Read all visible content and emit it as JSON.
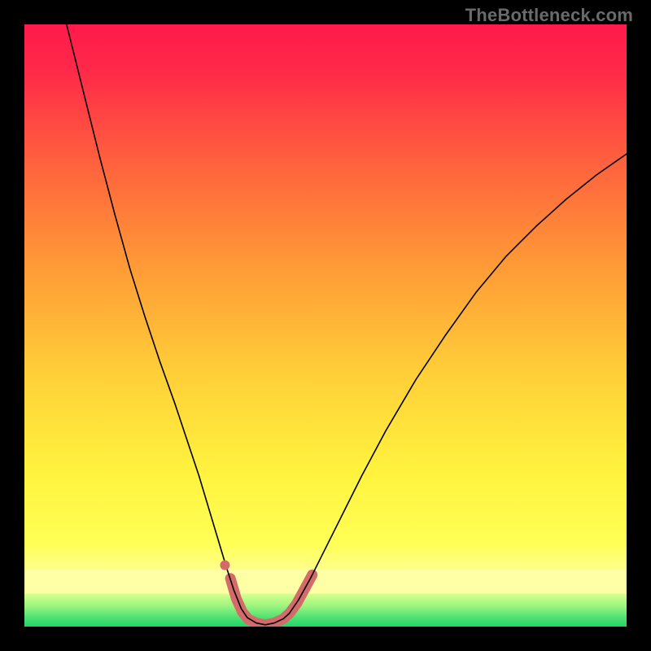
{
  "watermark": "TheBottleneck.com",
  "chart_data": {
    "type": "line",
    "title": "",
    "xlabel": "",
    "ylabel": "",
    "xlim": [
      0,
      100
    ],
    "ylim": [
      0,
      100
    ],
    "grid": false,
    "legend": false,
    "background_gradient": {
      "top_color": "#ff1a4b",
      "mid_color": "#ffe03a",
      "band_color": "#ffff8a",
      "bottom_color": "#2cdc6b"
    },
    "series": [
      {
        "name": "v-curve",
        "type": "line",
        "stroke": "#000000",
        "stroke_width": 1.6,
        "points": [
          {
            "x": 7.0,
            "y": 100.0
          },
          {
            "x": 8.0,
            "y": 96.0
          },
          {
            "x": 10.0,
            "y": 88.0
          },
          {
            "x": 12.5,
            "y": 78.0
          },
          {
            "x": 15.0,
            "y": 68.5
          },
          {
            "x": 17.5,
            "y": 59.5
          },
          {
            "x": 20.0,
            "y": 51.5
          },
          {
            "x": 22.5,
            "y": 44.0
          },
          {
            "x": 25.0,
            "y": 37.0
          },
          {
            "x": 27.0,
            "y": 31.0
          },
          {
            "x": 29.0,
            "y": 25.0
          },
          {
            "x": 30.5,
            "y": 20.0
          },
          {
            "x": 32.0,
            "y": 15.0
          },
          {
            "x": 33.5,
            "y": 10.0
          },
          {
            "x": 34.8,
            "y": 6.0
          },
          {
            "x": 36.0,
            "y": 3.0
          },
          {
            "x": 37.0,
            "y": 1.5
          },
          {
            "x": 38.5,
            "y": 0.6
          },
          {
            "x": 40.0,
            "y": 0.3
          },
          {
            "x": 41.5,
            "y": 0.6
          },
          {
            "x": 43.0,
            "y": 1.3
          },
          {
            "x": 44.0,
            "y": 2.2
          },
          {
            "x": 45.5,
            "y": 4.4
          },
          {
            "x": 47.5,
            "y": 8.0
          },
          {
            "x": 50.0,
            "y": 13.0
          },
          {
            "x": 53.0,
            "y": 19.0
          },
          {
            "x": 56.0,
            "y": 25.0
          },
          {
            "x": 60.0,
            "y": 32.5
          },
          {
            "x": 65.0,
            "y": 41.0
          },
          {
            "x": 70.0,
            "y": 48.5
          },
          {
            "x": 75.0,
            "y": 55.5
          },
          {
            "x": 80.0,
            "y": 61.5
          },
          {
            "x": 85.0,
            "y": 66.5
          },
          {
            "x": 90.0,
            "y": 71.0
          },
          {
            "x": 95.0,
            "y": 75.0
          },
          {
            "x": 100.0,
            "y": 78.5
          }
        ]
      },
      {
        "name": "highlight-band-left",
        "type": "line",
        "stroke": "#d46a6a",
        "stroke_width": 13,
        "linecap": "round",
        "points": [
          {
            "x": 34.2,
            "y": 8.0
          },
          {
            "x": 35.2,
            "y": 4.6
          },
          {
            "x": 36.2,
            "y": 2.4
          },
          {
            "x": 37.2,
            "y": 1.2
          },
          {
            "x": 38.5,
            "y": 0.6
          },
          {
            "x": 40.0,
            "y": 0.3
          },
          {
            "x": 41.5,
            "y": 0.6
          },
          {
            "x": 43.0,
            "y": 1.3
          },
          {
            "x": 44.0,
            "y": 2.2
          },
          {
            "x": 45.2,
            "y": 3.8
          },
          {
            "x": 46.4,
            "y": 6.0
          },
          {
            "x": 47.8,
            "y": 8.6
          }
        ]
      },
      {
        "name": "highlight-dot",
        "type": "scatter",
        "stroke": "#d46a6a",
        "radius": 6,
        "points": [
          {
            "x": 33.3,
            "y": 10.2
          }
        ]
      }
    ]
  }
}
